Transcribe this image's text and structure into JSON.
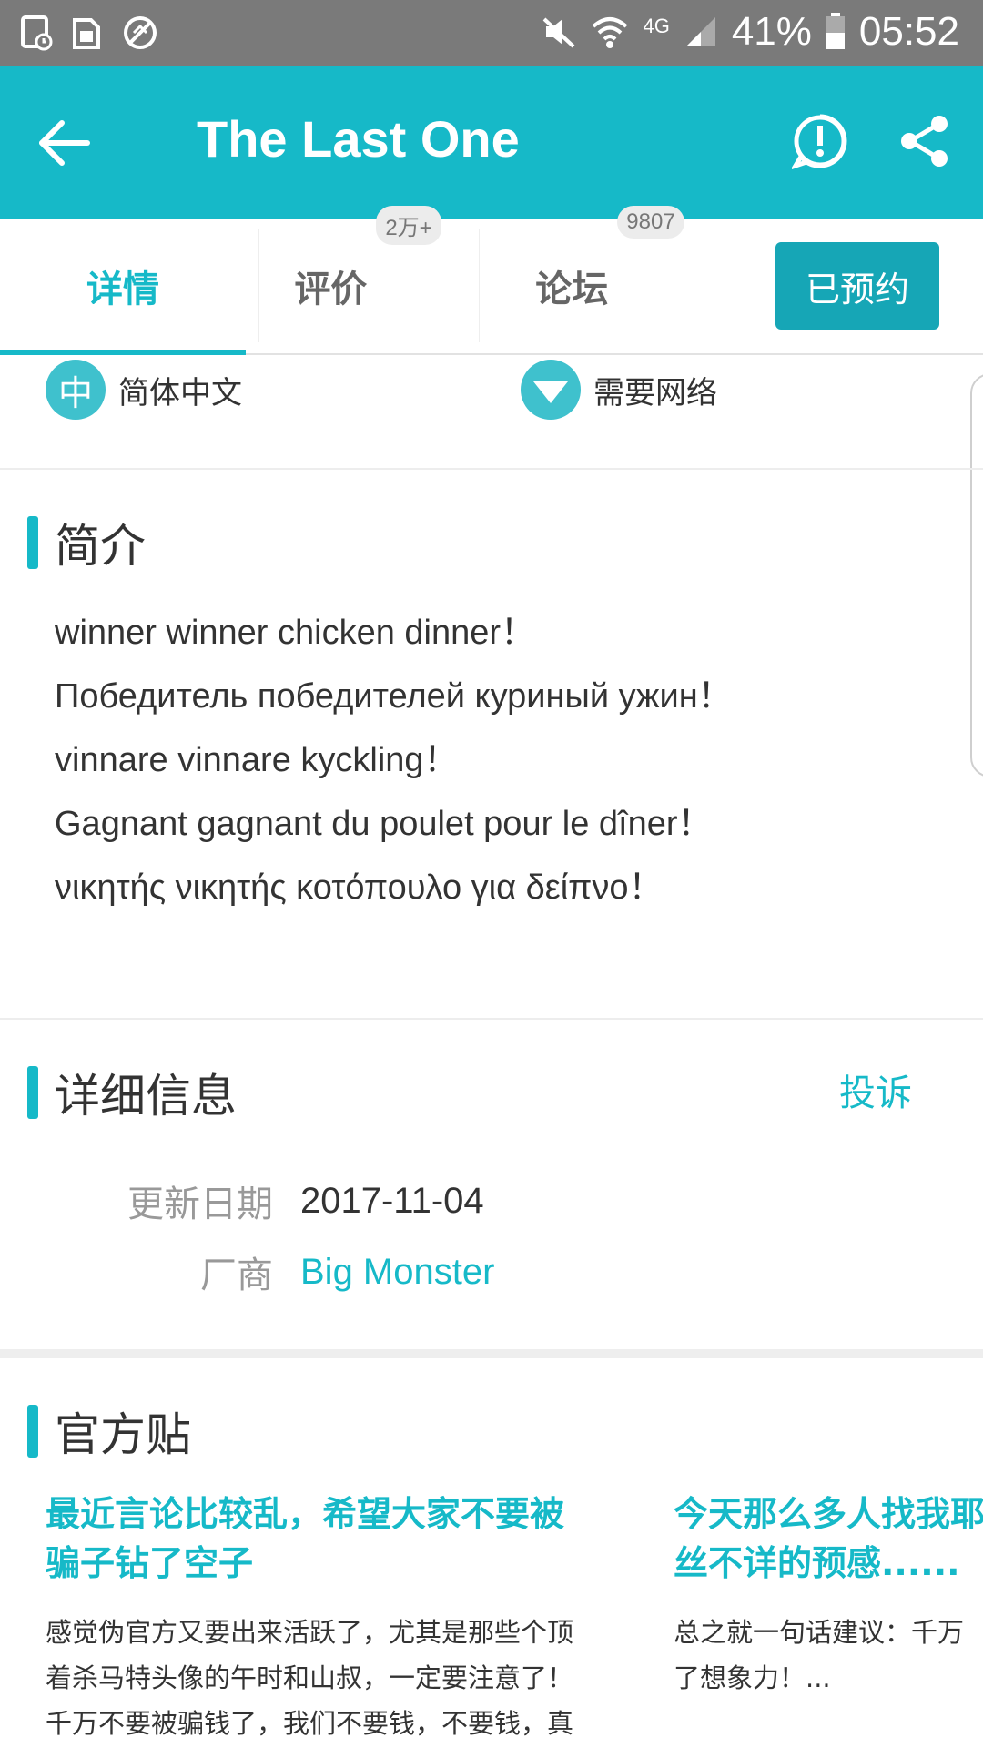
{
  "status_bar": {
    "left_icons": [
      "screenshot-icon",
      "sim-icon",
      "blocked-icon"
    ],
    "battery": "41%",
    "time": "05:52",
    "network": "4G"
  },
  "app_bar": {
    "title": "The Last One"
  },
  "tabs": [
    {
      "label": "详情",
      "badge": ""
    },
    {
      "label": "评价",
      "badge": "2万+"
    },
    {
      "label": "论坛",
      "badge": "9807"
    }
  ],
  "reserve_button": "已预约",
  "features": [
    {
      "icon_text": "中",
      "label": "简体中文"
    },
    {
      "label": "需要网络"
    }
  ],
  "intro": {
    "title": "简介",
    "lines": [
      "winner winner chicken dinner！",
      "Победитель победителей куриный ужин！",
      "vinnare vinnare kyckling！",
      "Gagnant gagnant du poulet pour le dîner！",
      "νικητής νικητής κοτόπουλο για δείπνο！"
    ]
  },
  "details": {
    "title": "详细信息",
    "complaint": "投诉",
    "update_date_label": "更新日期",
    "update_date": "2017-11-04",
    "vendor_label": "厂商",
    "vendor": "Big Monster"
  },
  "official_posts": {
    "title": "官方贴",
    "posts": [
      {
        "title_lines": [
          "最近言论比较乱，希望大家不要被",
          "骗子钻了空子"
        ],
        "body_lines": [
          "感觉伪官方又要出来活跃了，尤其是那些个顶",
          "着杀马特头像的午时和山叔，一定要注意了！",
          "千万不要被骗钱了，我们不要钱，不要钱，真"
        ]
      },
      {
        "title_lines": [
          "今天那么多人找我耶",
          "丝不详的预感......"
        ],
        "body_lines": [
          "总之就一句话建议：千万",
          "了想象力！..."
        ]
      }
    ]
  },
  "colors": {
    "accent": "#16b9c8",
    "status_bar": "#7a7a7a",
    "button": "#16a6b6"
  }
}
